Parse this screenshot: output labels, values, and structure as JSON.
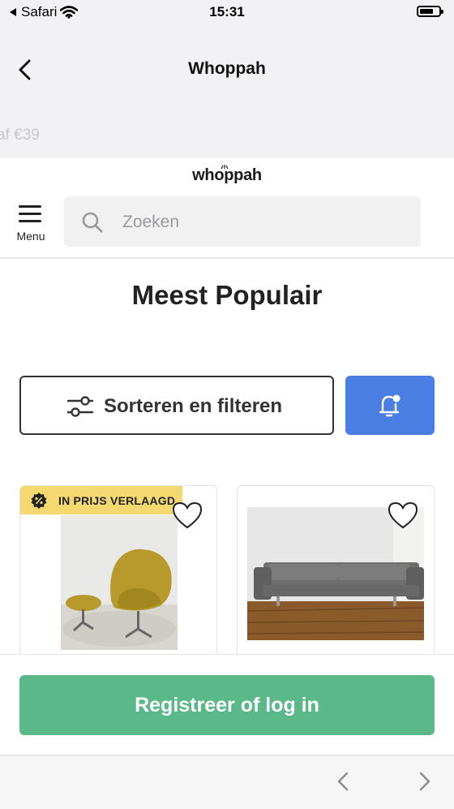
{
  "status_bar": {
    "carrier": "Safari",
    "time": "15:31"
  },
  "nav": {
    "title": "Whoppah"
  },
  "strip": {
    "text": "af €39"
  },
  "site": {
    "logo": "whoppah",
    "menu_label": "Menu"
  },
  "search": {
    "placeholder": "Zoeken",
    "value": ""
  },
  "page": {
    "title": "Meest Populair"
  },
  "filter": {
    "label": "Sorteren en filteren"
  },
  "products": [
    {
      "badge": "IN PRIJS VERLAAGD",
      "image": "yellow egg chair with footstool",
      "favorited": false
    },
    {
      "badge": "",
      "image": "grey three-seat sofa",
      "favorited": false
    }
  ],
  "cta": {
    "label": "Registreer of log in"
  },
  "colors": {
    "accent_blue": "#4a7ee3",
    "cta_green": "#5bb889",
    "badge_yellow": "#f4d970"
  }
}
